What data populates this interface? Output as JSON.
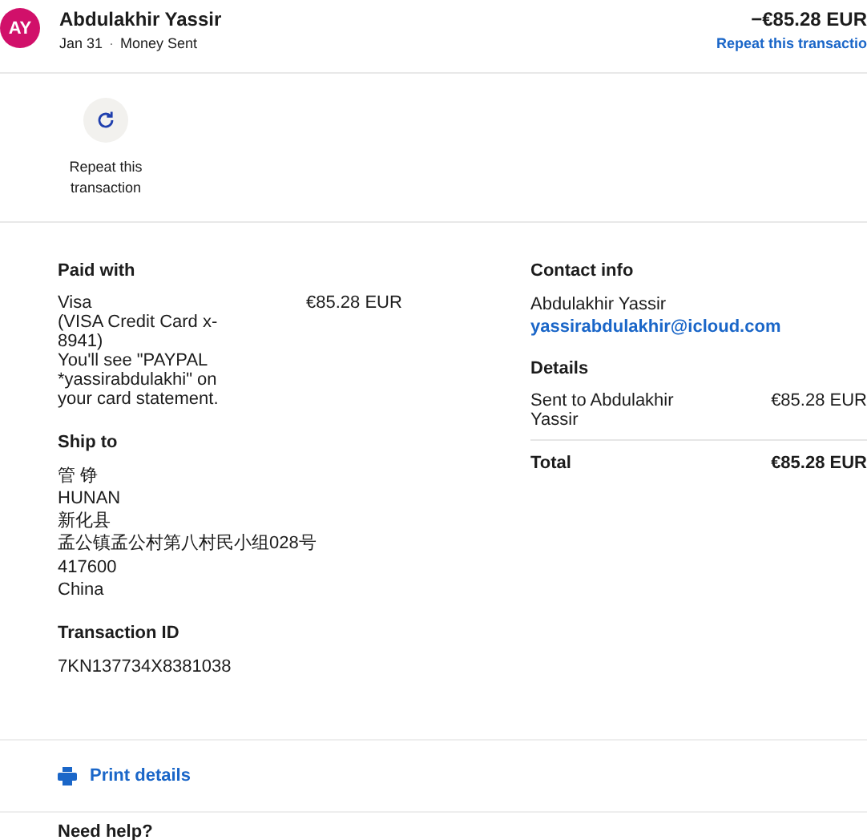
{
  "header": {
    "avatar": "AY",
    "name": "Abdulakhir Yassir",
    "date": "Jan 31",
    "separator": "·",
    "type": "Money Sent",
    "amount": "−€85.28 EUR",
    "repeat_link": "Repeat this transactio"
  },
  "actions": [
    {
      "label": "Repeat this transaction"
    }
  ],
  "paid_with": {
    "title": "Paid with",
    "method": "Visa",
    "card": "(VISA Credit Card x-8941)",
    "note": "You'll see \"PAYPAL *yassirabdulakhi\" on your card statement.",
    "amount": "€85.28 EUR"
  },
  "ship_to": {
    "title": "Ship to",
    "lines": [
      "管 铮",
      "HUNAN",
      "新化县",
      "孟公镇孟公村第八村民小组028号",
      "417600",
      "China"
    ]
  },
  "transaction_id": {
    "title": "Transaction ID",
    "value": "7KN137734X8381038"
  },
  "contact_info": {
    "title": "Contact info",
    "name": "Abdulakhir Yassir",
    "email": "yassirabdulakhir@icloud.com"
  },
  "details": {
    "title": "Details",
    "rows": [
      {
        "label": "Sent to Abdulakhir Yassir",
        "amount": "€85.28 EUR"
      }
    ],
    "total_label": "Total",
    "total_amount": "€85.28 EUR"
  },
  "print": {
    "label": "Print details"
  },
  "help": {
    "title": "Need help?"
  }
}
